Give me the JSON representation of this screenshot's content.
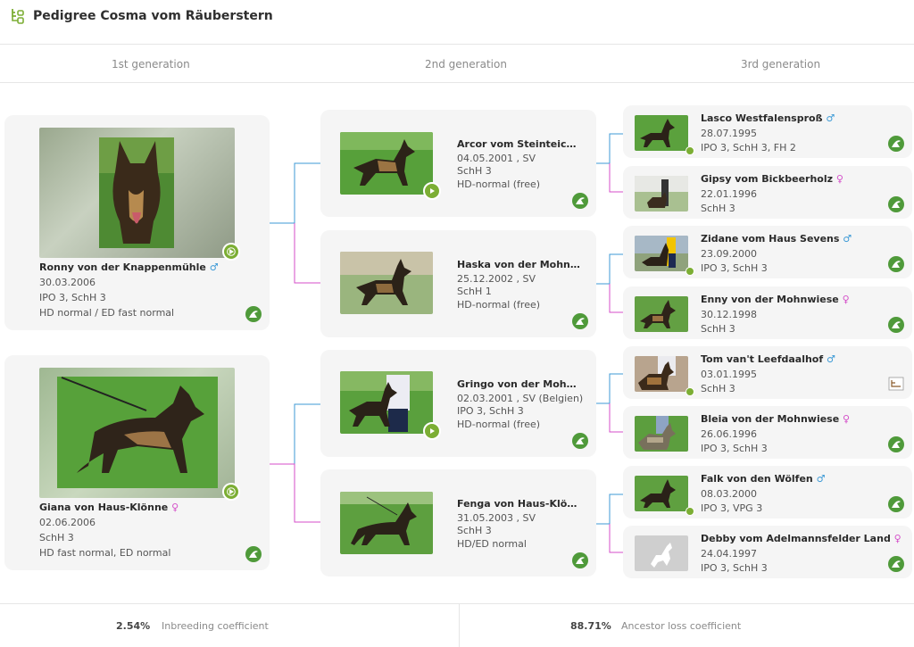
{
  "header": {
    "title": "Pedigree Cosma vom Räuberstern",
    "logo_icon": "pedigree-tree-icon"
  },
  "generations": {
    "first": "1st generation",
    "second": "2nd generation",
    "third": "3rd generation"
  },
  "colors": {
    "male": "#3d9ad6",
    "female": "#d44ec9",
    "accent_green": "#7cae34"
  },
  "gen1": [
    {
      "name": "Ronny von der Knappenmühle",
      "sex": "♂",
      "date": "30.03.2006",
      "titles": "IPO 3, SchH 3",
      "health": "HD normal / ED fast normal"
    },
    {
      "name": "Giana von Haus-Klönne",
      "sex": "♀",
      "date": "02.06.2006",
      "titles": "SchH 3",
      "health": "HD fast normal, ED normal"
    }
  ],
  "gen2": [
    {
      "name": "Arcor vom Steinteich",
      "sex": "♂",
      "date": "04.05.2001 , SV",
      "titles": "SchH 3",
      "health": "HD-normal (free)"
    },
    {
      "name": "Haska von der Mohnw…",
      "sex": "",
      "date": "25.12.2002 , SV",
      "titles": "SchH 1",
      "health": "HD-normal (free)"
    },
    {
      "name": "Gringo von der Mohnw…",
      "sex": "",
      "date": "02.03.2001 , SV (Belgien)",
      "titles": "IPO 3, SchH 3",
      "health": "HD-normal (free)"
    },
    {
      "name": "Fenga von Haus-Klönn…",
      "sex": "",
      "date": "31.05.2003 , SV",
      "titles": "SchH 3",
      "health": "HD/ED normal"
    }
  ],
  "gen3": [
    {
      "name": "Lasco Westfalensproß",
      "sex": "♂",
      "date": "28.07.1995",
      "titles": "IPO 3, SchH 3, FH 2"
    },
    {
      "name": "Gipsy vom Bickbeerholz",
      "sex": "♀",
      "date": "22.01.1996",
      "titles": "SchH 3"
    },
    {
      "name": "Zidane vom Haus Sevens",
      "sex": "♂",
      "date": "23.09.2000",
      "titles": "IPO 3, SchH 3"
    },
    {
      "name": "Enny von der Mohnwiese",
      "sex": "♀",
      "date": "30.12.1998",
      "titles": "SchH 3"
    },
    {
      "name": "Tom van't Leefdaalhof",
      "sex": "♂",
      "date": "03.01.1995",
      "titles": "SchH 3"
    },
    {
      "name": "Bleia von der Mohnwiese",
      "sex": "♀",
      "date": "26.06.1996",
      "titles": "IPO 3, SchH 3"
    },
    {
      "name": "Falk von den Wölfen",
      "sex": "♂",
      "date": "08.03.2000",
      "titles": "IPO 3, VPG 3"
    },
    {
      "name": "Debby vom Adelmannsfelder Land",
      "sex": "♀",
      "date": "24.04.1997",
      "titles": "IPO 3, SchH 3"
    }
  ],
  "footer": {
    "inbreeding_value": "2.54%",
    "inbreeding_label": "Inbreeding coefficient",
    "ancestor_value": "88.71%",
    "ancestor_label": "Ancestor loss coefficient"
  }
}
